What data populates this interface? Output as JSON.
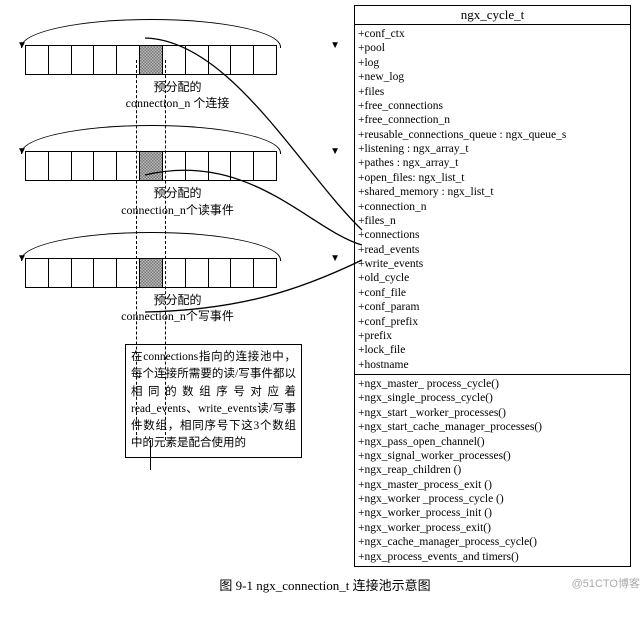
{
  "class": {
    "title": "ngx_cycle_t",
    "fields": [
      "+conf_ctx",
      "+pool",
      "+log",
      "+new_log",
      "+files",
      "+free_connections",
      "+free_connection_n",
      "+reusable_connections_queue : ngx_queue_s",
      "+listening :  ngx_array_t",
      "+pathes :  ngx_array_t",
      "+open_files:  ngx_list_t",
      "+shared_memory : ngx_list_t",
      "+connection_n",
      "+files_n",
      "+connections",
      "+read_events",
      "+write_events",
      "+old_cycle",
      "+conf_file",
      "+conf_param",
      "+conf_prefix",
      "+prefix",
      "+lock_file",
      "+hostname"
    ],
    "methods": [
      "+ngx_master_ process_cycle()",
      "+ngx_single_process_cycle()",
      "+ngx_start _worker_processes()",
      "+ngx_start_cache_manager_processes()",
      "+ngx_pass_open_channel()",
      "+ngx_signal_worker_processes()",
      "+ngx_reap_children ()",
      "+ngx_master_process_exit ()",
      "+ngx_worker _process_cycle ()",
      "+ngx_worker_process_init ()",
      "+ngx_worker_process_exit()",
      "+ngx_cache_manager_process_cycle()",
      "+ngx_process_events_and timers()"
    ]
  },
  "pools": [
    {
      "label_cn": "预分配的",
      "label_sub": "connection_n 个连接"
    },
    {
      "label_cn": "预分配的",
      "label_sub": "connection_n个读事件"
    },
    {
      "label_cn": "预分配的",
      "label_sub": "connection_n个写事件"
    }
  ],
  "note": "在connections指向的连接池中，每个连接所需要的读/写事件都以相同的数组序号对应着read_events、write_events读/写事件数组，相同序号下这3个数组中的元素是配合使用的",
  "caption": "图 9-1  ngx_connection_t 连接池示意图",
  "watermark": "@51CTO博客",
  "pool_cells": 11,
  "shaded_index": 5
}
